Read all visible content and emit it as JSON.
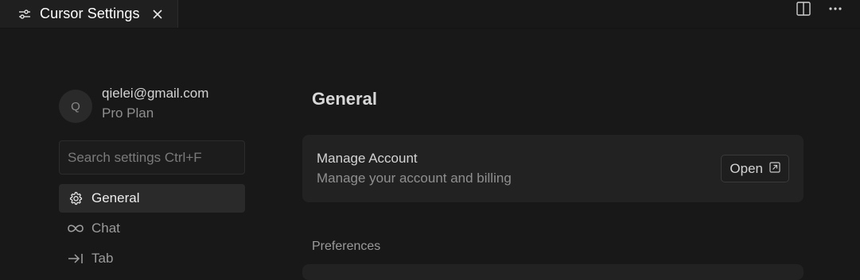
{
  "tab": {
    "title": "Cursor Settings",
    "icon": "settings-sliders-icon",
    "close_icon": "close-icon"
  },
  "toolbar": {
    "split_icon": "split-editor-icon",
    "more_icon": "more-actions-icon"
  },
  "account": {
    "initial": "Q",
    "email": "qielei@gmail.com",
    "plan": "Pro Plan"
  },
  "search": {
    "placeholder": "Search settings Ctrl+F",
    "value": ""
  },
  "nav": {
    "items": [
      {
        "label": "General",
        "icon": "gear-icon",
        "active": true
      },
      {
        "label": "Chat",
        "icon": "infinity-icon",
        "active": false
      },
      {
        "label": "Tab",
        "icon": "tab-arrow-icon",
        "active": false
      }
    ]
  },
  "main": {
    "title": "General",
    "manage_account": {
      "title": "Manage Account",
      "description": "Manage your account and billing",
      "button_label": "Open",
      "button_icon": "external-link-icon"
    },
    "preferences_label": "Preferences"
  },
  "colors": {
    "background": "#181818",
    "card": "#222222",
    "active_nav": "#2a2a2a"
  }
}
